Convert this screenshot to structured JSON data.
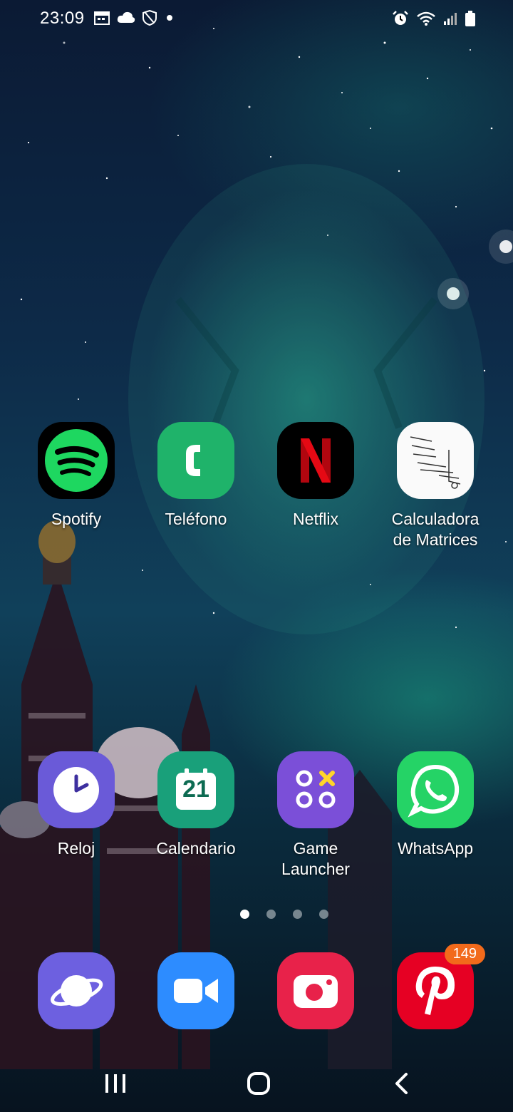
{
  "status_bar": {
    "time": "23:09",
    "left_icons": [
      "calendar-icon",
      "cloud-icon",
      "shield-icon",
      "notification-dot-icon"
    ],
    "right_icons": [
      "alarm-icon",
      "wifi-icon",
      "signal-icon",
      "battery-icon"
    ]
  },
  "home": {
    "row1": [
      {
        "id": "spotify",
        "label": "Spotify",
        "icon": "spotify-icon",
        "color": "#1ed760"
      },
      {
        "id": "telefono",
        "label": "Teléfono",
        "icon": "phone-icon",
        "color": "#1fb36a"
      },
      {
        "id": "netflix",
        "label": "Netflix",
        "icon": "netflix-icon",
        "color": "#e50914"
      },
      {
        "id": "calculadora",
        "label": "Calculadora\nde Matrices",
        "icon": "matrix-calculator-icon",
        "color": "#ffffff"
      }
    ],
    "row2": [
      {
        "id": "reloj",
        "label": "Reloj",
        "icon": "clock-icon",
        "color": "#6a5ad8"
      },
      {
        "id": "calendario",
        "label": "Calendario",
        "icon": "calendar-app-icon",
        "color": "#19a07a",
        "day": "21"
      },
      {
        "id": "game-launcher",
        "label": "Game\nLauncher",
        "icon": "game-launcher-icon",
        "color": "#7b4fd8"
      },
      {
        "id": "whatsapp",
        "label": "WhatsApp",
        "icon": "whatsapp-icon",
        "color": "#25d366"
      }
    ],
    "page_indicator": {
      "pages": 4,
      "current": 1
    }
  },
  "dock": [
    {
      "id": "internet",
      "icon": "internet-browser-icon",
      "color": "#6d60e0"
    },
    {
      "id": "zoom",
      "icon": "zoom-video-icon",
      "color": "#2d8cff"
    },
    {
      "id": "camera",
      "icon": "camera-icon",
      "color": "#e8224a"
    },
    {
      "id": "pinterest",
      "icon": "pinterest-icon",
      "color": "#e60023",
      "badge": "149"
    }
  ],
  "nav_bar": {
    "buttons": [
      "recent-apps-icon",
      "home-icon",
      "back-icon"
    ]
  }
}
